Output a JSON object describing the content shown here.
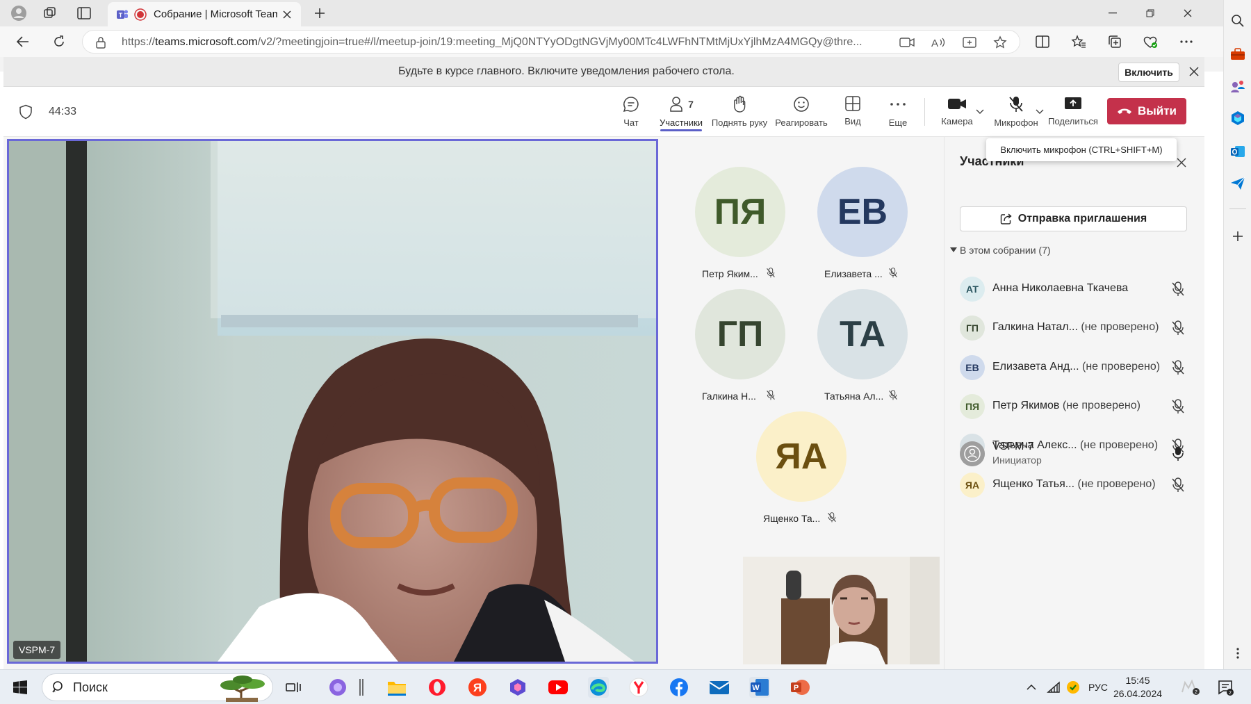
{
  "browser": {
    "tab_title": "Собрание | Microsoft Teams",
    "url_prefix": "https://",
    "url_domain": "teams.microsoft.com",
    "url_rest": "/v2/?meetingjoin=true#/l/meetup-join/19:meeting_MjQ0NTYyODgtNGVjMy00MTc4LWFhNTMtMjUxYjlhMzA4MGQy@thre..."
  },
  "notification": {
    "text": "Будьте в курсе главного. Включите уведомления рабочего стола.",
    "enable_label": "Включить"
  },
  "meeting_bar": {
    "timer": "44:33",
    "participants_count": "7",
    "tools": {
      "chat": "Чат",
      "participants": "Участники",
      "raise_hand": "Поднять руку",
      "react": "Реагировать",
      "view": "Вид",
      "more": "Еще",
      "camera": "Камера",
      "mic": "Микрофон",
      "share": "Поделиться"
    },
    "leave_label": "Выйти"
  },
  "tooltip": "Включить микрофон (CTRL+SHIFT+M)",
  "main_video": {
    "label": "VSPM-7"
  },
  "gallery": [
    {
      "initials": "ПЯ",
      "name": "Петр Яким...",
      "bg": "#e4ebdb",
      "fg": "#3f5a2a"
    },
    {
      "initials": "ЕВ",
      "name": "Елизавета ...",
      "bg": "#cfdaec",
      "fg": "#24385f"
    },
    {
      "initials": "ГП",
      "name": "Галкина Н...",
      "bg": "#e0e6dc",
      "fg": "#36452f"
    },
    {
      "initials": "ТА",
      "name": "Татьяна Ал...",
      "bg": "#d9e2e6",
      "fg": "#2c3f46"
    },
    {
      "initials": "ЯА",
      "name": "Ященко Та...",
      "bg": "#fbf0c9",
      "fg": "#6b4f10"
    }
  ],
  "panel": {
    "title": "Участники",
    "invite_label": "Отправка приглашения",
    "section_label": "В этом собрании (7)",
    "participants": [
      {
        "initials": "АТ",
        "name": "Анна Николаевна Ткачева",
        "status": "",
        "bg": "#dcecef",
        "fg": "#2b5660"
      },
      {
        "initials": "ГП",
        "name": "Галкина Натал...",
        "status": "(не проверено)",
        "bg": "#e0e6dc",
        "fg": "#36452f"
      },
      {
        "initials": "ЕВ",
        "name": "Елизавета Анд...",
        "status": "(не проверено)",
        "bg": "#cfdaec",
        "fg": "#24385f"
      },
      {
        "initials": "ПЯ",
        "name": "Петр Якимов",
        "status": "(не проверено)",
        "bg": "#e4ebdb",
        "fg": "#3f5a2a"
      },
      {
        "initials": "ТА",
        "name": "Татьяна Алекс...",
        "status": "(не проверено)",
        "bg": "#d9e2e6",
        "fg": "#2c3f46"
      },
      {
        "initials": "ЯА",
        "name": "Ященко Татья...",
        "status": "(не проверено)",
        "bg": "#fbf0c9",
        "fg": "#6b4f10"
      }
    ],
    "organizer": {
      "name": "VSPM-7",
      "role": "Инициатор"
    }
  },
  "taskbar": {
    "search_placeholder": "Поиск",
    "lang": "РУС",
    "time": "15:45",
    "date": "26.04.2024",
    "notif_count": "2"
  },
  "colors": {
    "leave": "#c4314b",
    "accent": "#5b5fc7",
    "active_border": "#6a68d7"
  }
}
